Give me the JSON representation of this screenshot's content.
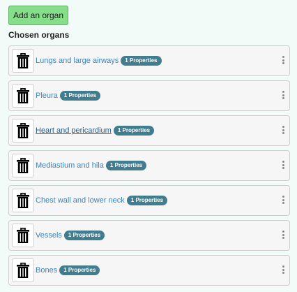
{
  "add_button_label": "Add an organ",
  "section_title": "Chosen organs",
  "organs": [
    {
      "name": "Lungs and large airways",
      "badge": "1 Properties"
    },
    {
      "name": "Pleura",
      "badge": "1 Properties"
    },
    {
      "name": "Heart and pericardium",
      "badge": "1 Properties"
    },
    {
      "name": "Mediastium and hila",
      "badge": "1 Properties"
    },
    {
      "name": "Chest wall and lower neck",
      "badge": "1 Properties"
    },
    {
      "name": "Vessels",
      "badge": "1 Properties"
    },
    {
      "name": "Bones",
      "badge": "1 Properties"
    }
  ],
  "icons": {
    "delete": "trash-icon",
    "menu": "kebab-menu-icon"
  },
  "colors": {
    "add_button": "#86dd8a",
    "link": "#3b83bd",
    "badge": "#427c8f",
    "background": "#f3fbf9"
  }
}
